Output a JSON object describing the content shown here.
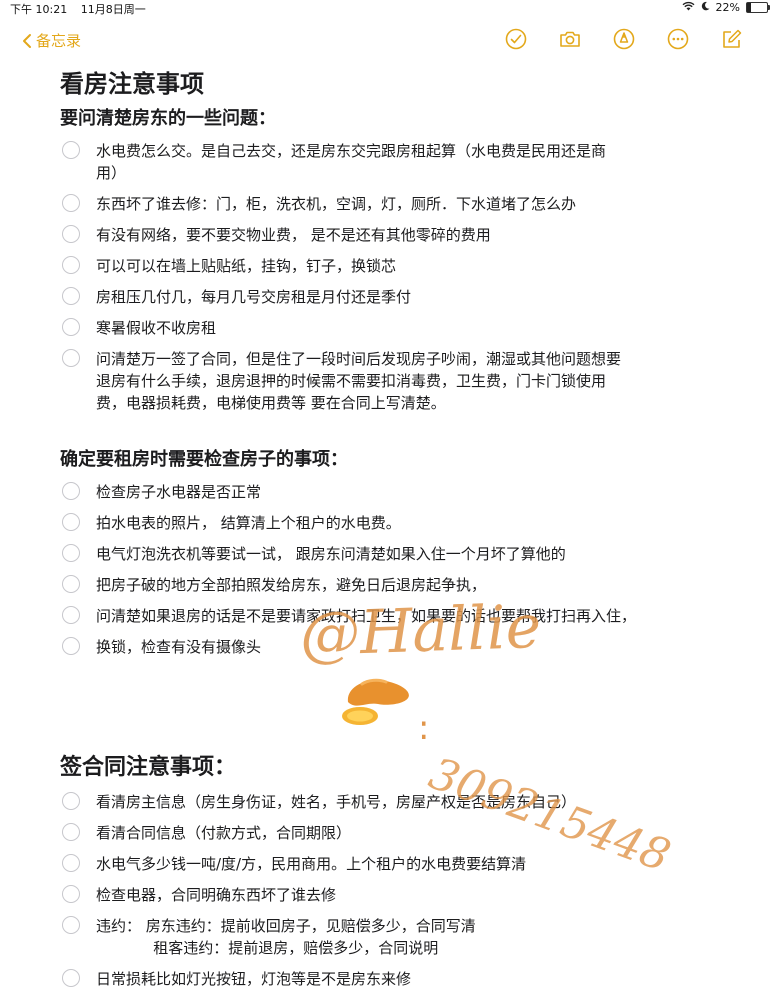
{
  "status": {
    "time": "下午 10:21",
    "date": "11月8日周一",
    "battery": "22%",
    "battery_level": 0.22
  },
  "nav": {
    "back_label": "备忘录"
  },
  "note": {
    "title": "看房注意事项",
    "sections": [
      {
        "heading": "要问清楚房东的一些问题：",
        "items": [
          [
            "水电费怎么交。是自己去交，还是房东交完跟房租起算（水电费是民用还是商",
            "用）"
          ],
          [
            "东西坏了谁去修：门，柜，洗衣机，空调，灯，厕所．下水道堵了怎么办"
          ],
          [
            "有没有网络，要不要交物业费， 是不是还有其他零碎的费用"
          ],
          [
            " 可以可以在墙上贴贴纸，挂钩，钉子，换锁芯"
          ],
          [
            "房租压几付几，每月几号交房租是月付还是季付"
          ],
          [
            "寒暑假收不收房租"
          ],
          [
            "问清楚万一签了合同，但是住了一段时间后发现房子吵闹，潮湿或其他问题想要",
            "退房有什么手续，退房退押的时候需不需要扣消毒费，卫生费，门卡门锁使用",
            "费，电器损耗费，电梯使用费等 要在合同上写清楚。"
          ]
        ]
      },
      {
        "heading": "确定要租房时需要检查房子的事项：",
        "items": [
          [
            "检查房子水电器是否正常"
          ],
          [
            "拍水电表的照片， 结算清上个租户的水电费。"
          ],
          [
            "电气灯泡洗衣机等要试一试， 跟房东问清楚如果入住一个月坏了算他的"
          ],
          [
            "把房子破的地方全部拍照发给房东，避免日后退房起争执，"
          ],
          [
            "问清楚如果退房的话是不是要请家政打扫卫生，如果要的话也要帮我打扫再入住，"
          ],
          [
            "换锁，检查有没有摄像头"
          ]
        ]
      },
      {
        "heading": "签合同注意事项：",
        "items": [
          [
            "看清房主信息（房生身伤证，姓名，手机号，房屋产权是否是房东自己）"
          ],
          [
            "看清合同信息（付款方式，合同期限）"
          ],
          [
            "水电气多少钱一吨/度/方，民用商用。上个租户的水电费要结算清"
          ],
          [
            "检查电器，合同明确东西坏了谁去修"
          ],
          [
            "违约： 房东违约：提前收回房子，见赔偿多少，合同写清",
            "            租客违约：提前退房，赔偿多少，合同说明"
          ],
          [
            "日常损耗比如灯光按钮，灯泡等是不是房东来修"
          ]
        ]
      }
    ]
  },
  "watermark": {
    "handle": "@Hallie",
    "colon": ":",
    "number": "309215448"
  },
  "colors": {
    "accent": "#e3a81b",
    "watermark": "#e0954a"
  }
}
